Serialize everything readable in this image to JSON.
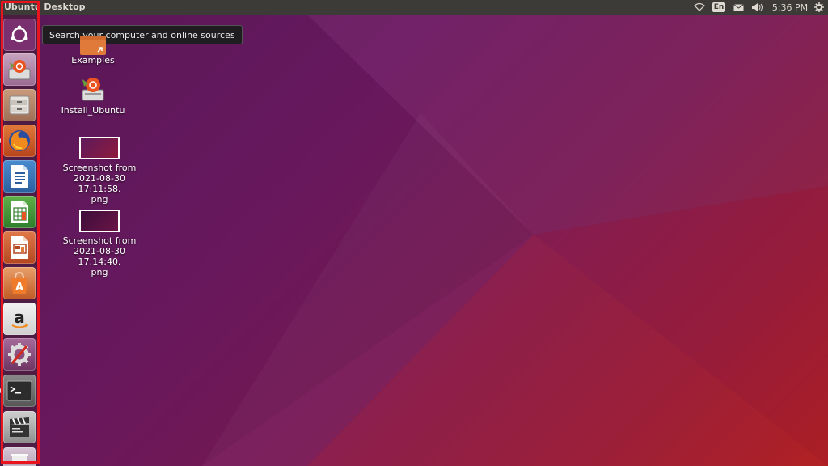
{
  "top_panel": {
    "title": "Ubuntu Desktop",
    "keyboard_layout": "En",
    "clock": "5:36 PM",
    "icons": [
      "wifi-icon",
      "keyboard-layout-icon",
      "mail-icon",
      "volume-icon",
      "settings-gear-icon"
    ]
  },
  "tooltip": "Search your computer and online sources",
  "launcher": {
    "items": [
      {
        "name": "search-dash-icon",
        "label": "Search your computer and online sources"
      },
      {
        "name": "install-ubuntu-icon"
      },
      {
        "name": "files-icon"
      },
      {
        "name": "firefox-icon"
      },
      {
        "name": "libreoffice-writer-icon"
      },
      {
        "name": "libreoffice-calc-icon"
      },
      {
        "name": "libreoffice-impress-icon"
      },
      {
        "name": "ubuntu-software-icon"
      },
      {
        "name": "amazon-icon"
      },
      {
        "name": "system-settings-icon"
      },
      {
        "name": "terminal-icon"
      },
      {
        "name": "videos-icon"
      },
      {
        "name": "trash-icon"
      }
    ]
  },
  "desktop": {
    "icons": [
      {
        "label": "Examples"
      },
      {
        "label": "Install_Ubuntu"
      },
      {
        "label_lines": [
          "Screenshot from",
          "2021-08-30 17:11:58.",
          "png"
        ]
      },
      {
        "label_lines": [
          "Screenshot from",
          "2021-08-30 17:14:40.",
          "png"
        ]
      }
    ]
  },
  "colors": {
    "panel": "#3c3b37",
    "highlight": "#e8141e",
    "ubuntu_orange": "#e95420"
  }
}
